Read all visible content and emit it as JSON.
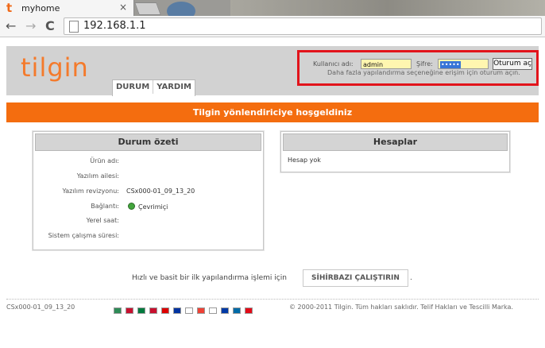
{
  "browser": {
    "tab_logo": "t",
    "tab_title": "myhome",
    "tab_close": "×",
    "address": "192.168.1.1",
    "back_icon": "←",
    "forward_icon": "→",
    "reload_icon": "C"
  },
  "header": {
    "logo": "tilgin",
    "menu": [
      "DURUM",
      "YARDIM"
    ],
    "username_label": "Kullanıcı adı:",
    "username_value": "admin",
    "password_label": "Şifre:",
    "password_value": "•••••",
    "login_button": "Oturum aç",
    "hint": "Daha fazla yapılandırma seçeneğine erişim için oturum açın."
  },
  "banner": "Tilgin yönlendiriciye hoşgeldiniz",
  "status": {
    "title": "Durum özeti",
    "rows": [
      {
        "label": "Ürün adı:",
        "value": ""
      },
      {
        "label": "Yazılım ailesi:",
        "value": ""
      },
      {
        "label": "Yazılım revizyonu:",
        "value": "CSx000-01_09_13_20"
      },
      {
        "label": "Bağlantı:",
        "value": "Çevrimiçi"
      },
      {
        "label": "Yerel saat:",
        "value": ""
      },
      {
        "label": "Sistem çalışma süresi:",
        "value": ""
      }
    ]
  },
  "accounts": {
    "title": "Hesaplar",
    "empty": "Hesap yok"
  },
  "setup": {
    "text": "Hızlı ve basit bir ilk yapılandırma işlemi için",
    "button": "SİHİRBAZI ÇALIŞTIRIN",
    "suffix": "."
  },
  "footer": {
    "version": "CSx000-01_09_13_20",
    "copyright": "© 2000-2011 Tilgin. Tüm hakları saklıdır. Telif Hakları ve Tescilli Marka.",
    "flag_colors": [
      "#2e8b57",
      "#c8102e",
      "#007a3d",
      "#c8102e",
      "#dd0000",
      "#0033a0",
      "#ffffff",
      "#ef4135",
      "#ffffff",
      "#0039a6",
      "#006aa7",
      "#e30a17"
    ]
  },
  "colors": {
    "accent": "#f46d0f",
    "highlight": "#e2141b"
  }
}
